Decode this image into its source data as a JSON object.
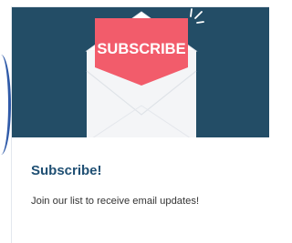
{
  "card": {
    "banner_label": "SUBSCRIBE",
    "title": "Subscribe!",
    "description": "Join our list to receive email updates!"
  },
  "colors": {
    "hero_background": "#234d66",
    "banner": "#f25c6b",
    "title": "#1f4f73",
    "text": "#333333"
  },
  "icons": [
    "envelope-icon",
    "sparkle-icon"
  ]
}
